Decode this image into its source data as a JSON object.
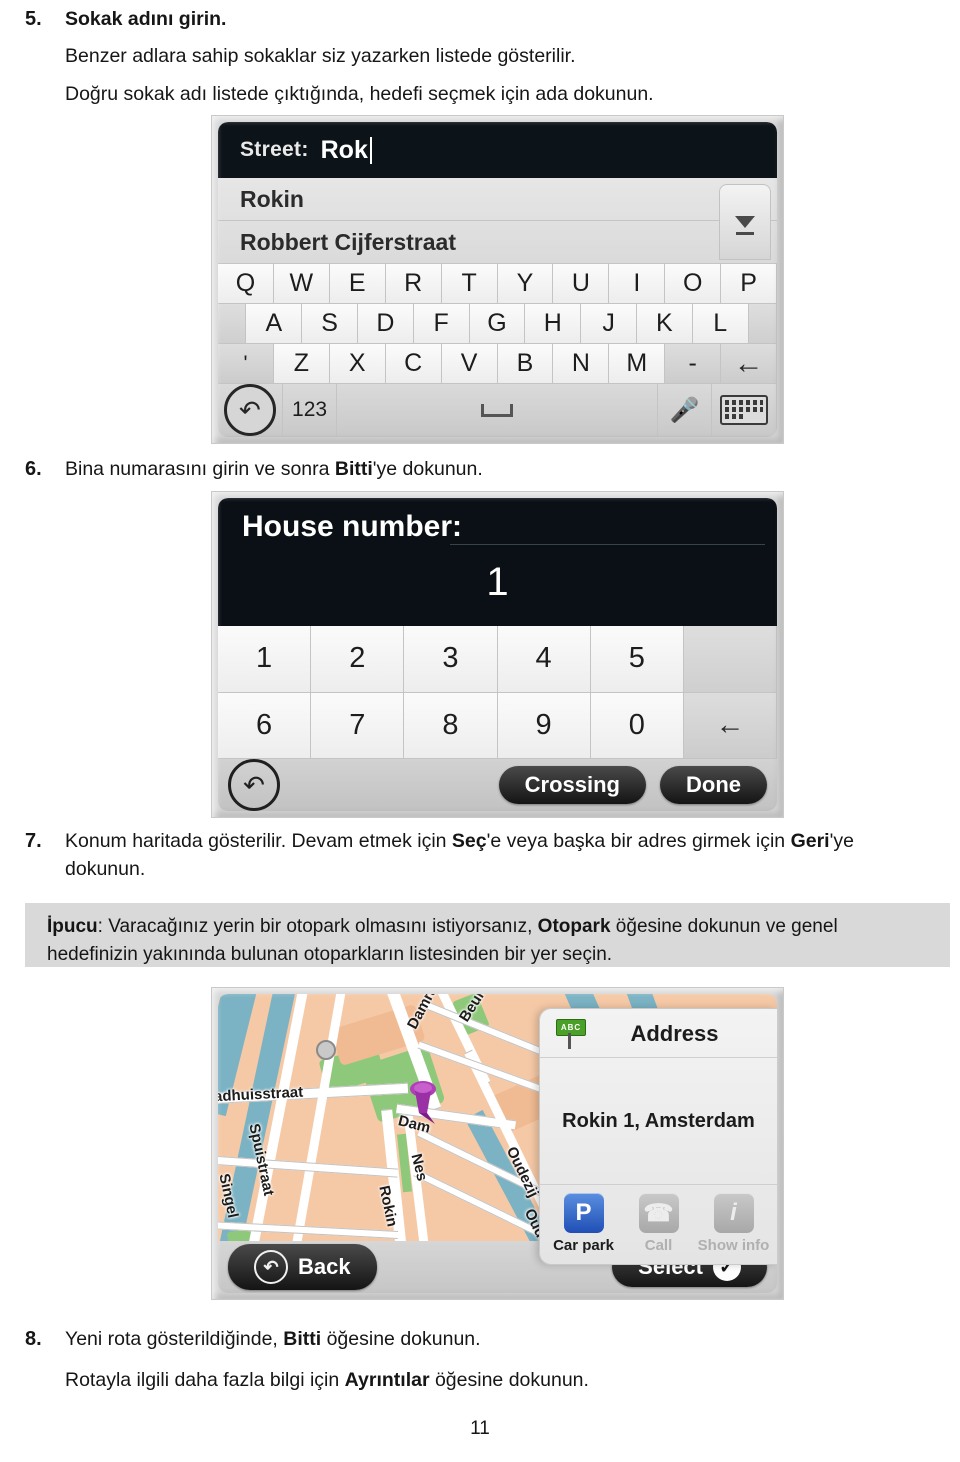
{
  "page": {
    "number": "11"
  },
  "steps": [
    {
      "num": "5.",
      "title": "Sokak adını girin.",
      "paras": [
        "Benzer adlara sahip sokaklar siz yazarken listede gösterilir.",
        "Doğru sokak adı listede çıktığında, hedefi seçmek için ada dokunun."
      ]
    },
    {
      "num": "6.",
      "text_before": "Bina numarasını girin ve sonra ",
      "text_bold": "Bitti",
      "text_after": "'ye dokunun."
    },
    {
      "num": "7.",
      "t1": "Konum haritada gösterilir. Devam etmek için ",
      "b1": "Seç",
      "t2": "'e veya başka bir adres girmek için ",
      "b2": "Geri",
      "t3": "'ye dokunun."
    },
    {
      "num": "8.",
      "t1": "Yeni rota gösterildiğinde, ",
      "b1": "Bitti",
      "t2": " öğesine dokunun.",
      "para": {
        "t1": "Rotayla ilgili daha fazla bilgi için ",
        "b1": "Ayrıntılar",
        "t2": " öğesine dokunun."
      }
    }
  ],
  "tip": {
    "label": "İpucu",
    "t1": ": Varacağınız yerin bir otopark olmasını istiyorsanız, ",
    "b1": "Otopark",
    "t2": " öğesine dokunun ve genel hedefinizin yakınında bulunan otoparkların listesinden bir yer seçin.",
    "background": "#d9d9d9"
  },
  "screen_street": {
    "title_label": "Street:",
    "title_value": "Rok",
    "suggestions": [
      "Rokin",
      "Robbert Cijferstraat"
    ],
    "scroll_icon": "triangle-down-icon",
    "keyboard": {
      "row1": [
        "Q",
        "W",
        "E",
        "R",
        "T",
        "Y",
        "U",
        "I",
        "O",
        "P"
      ],
      "row2": [
        "",
        "A",
        "S",
        "D",
        "F",
        "G",
        "H",
        "J",
        "K",
        "L",
        ""
      ],
      "row3": [
        "'",
        "Z",
        "X",
        "C",
        "V",
        "B",
        "N",
        "M",
        "-",
        "←"
      ],
      "row4_numeric": "123",
      "undo_icon": "undo-arrow-icon",
      "space_icon": "space-bar-icon",
      "mic_icon": "microphone-icon",
      "keyboard_icon": "keyboard-icon"
    }
  },
  "screen_house": {
    "label": "House number:",
    "value": "1",
    "keys_row1": [
      "1",
      "2",
      "3",
      "4",
      "5",
      ""
    ],
    "keys_row2": [
      "6",
      "7",
      "8",
      "9",
      "0",
      "←"
    ],
    "undo_icon": "undo-arrow-icon",
    "crossing_label": "Crossing",
    "done_label": "Done"
  },
  "screen_map": {
    "panel": {
      "sign_text": "ABC",
      "title": "Address",
      "address": "Rokin 1, Amsterdam",
      "actions": [
        {
          "label": "Car park",
          "icon": "parking-p-icon",
          "enabled": true
        },
        {
          "label": "Call",
          "icon": "phone-icon",
          "enabled": false
        },
        {
          "label": "Show info",
          "icon": "info-icon",
          "enabled": false
        }
      ]
    },
    "street_labels": [
      "adhuisstraat",
      "Damrak",
      "Beursplein",
      "Dam",
      "Nes",
      "Rokin",
      "Singel",
      "Spuistraat",
      "Oudezij",
      "Oude"
    ],
    "back_label": "Back",
    "select_label": "Select",
    "colors": {
      "land": "#f0bb93",
      "water": "#7bb3c4",
      "park": "#8ec87a",
      "road": "#ffffff",
      "pin": "#a game"
    }
  }
}
